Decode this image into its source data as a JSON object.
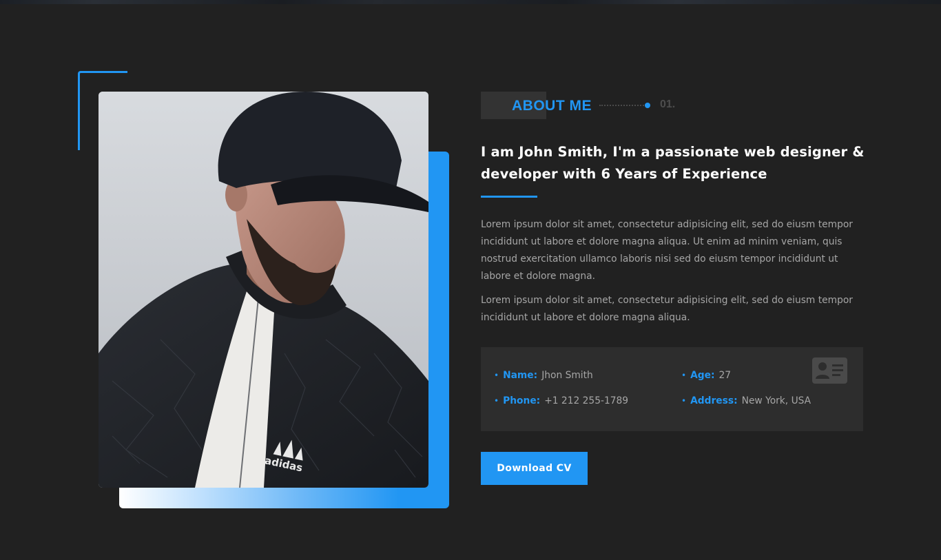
{
  "about": {
    "eyebrow": "ABOUT ME",
    "number": "01.",
    "headline": "I am John Smith, I'm a passionate web designer & developer with 6 Years of Experience",
    "paragraphs": [
      "Lorem ipsum dolor sit amet, consectetur adipisicing elit, sed do eiusm tempor incididunt ut labore et dolore magna aliqua. Ut enim ad minim veniam, quis nostrud exercitation ullamco laboris nisi sed do eiusm tempor incididunt ut labore et dolore magna.",
      "Lorem ipsum dolor sit amet, consectetur adipisicing elit, sed do eiusm tempor incididunt ut labore et dolore magna aliqua."
    ],
    "info": {
      "name_label": "Name:",
      "name_value": "Jhon Smith",
      "age_label": "Age:",
      "age_value": "27",
      "phone_label": "Phone:",
      "phone_value": "+1 212 255-1789",
      "address_label": "Address:",
      "address_value": "New York, USA",
      "icon": "id-card-icon"
    },
    "download_label": "Download CV",
    "photo_logo_text": "adidas"
  },
  "theme": {
    "accent": "#2196f3",
    "background": "#212121",
    "card": "#2d2d2d",
    "text_muted": "#a6a6a6",
    "heading": "#ffffff"
  }
}
